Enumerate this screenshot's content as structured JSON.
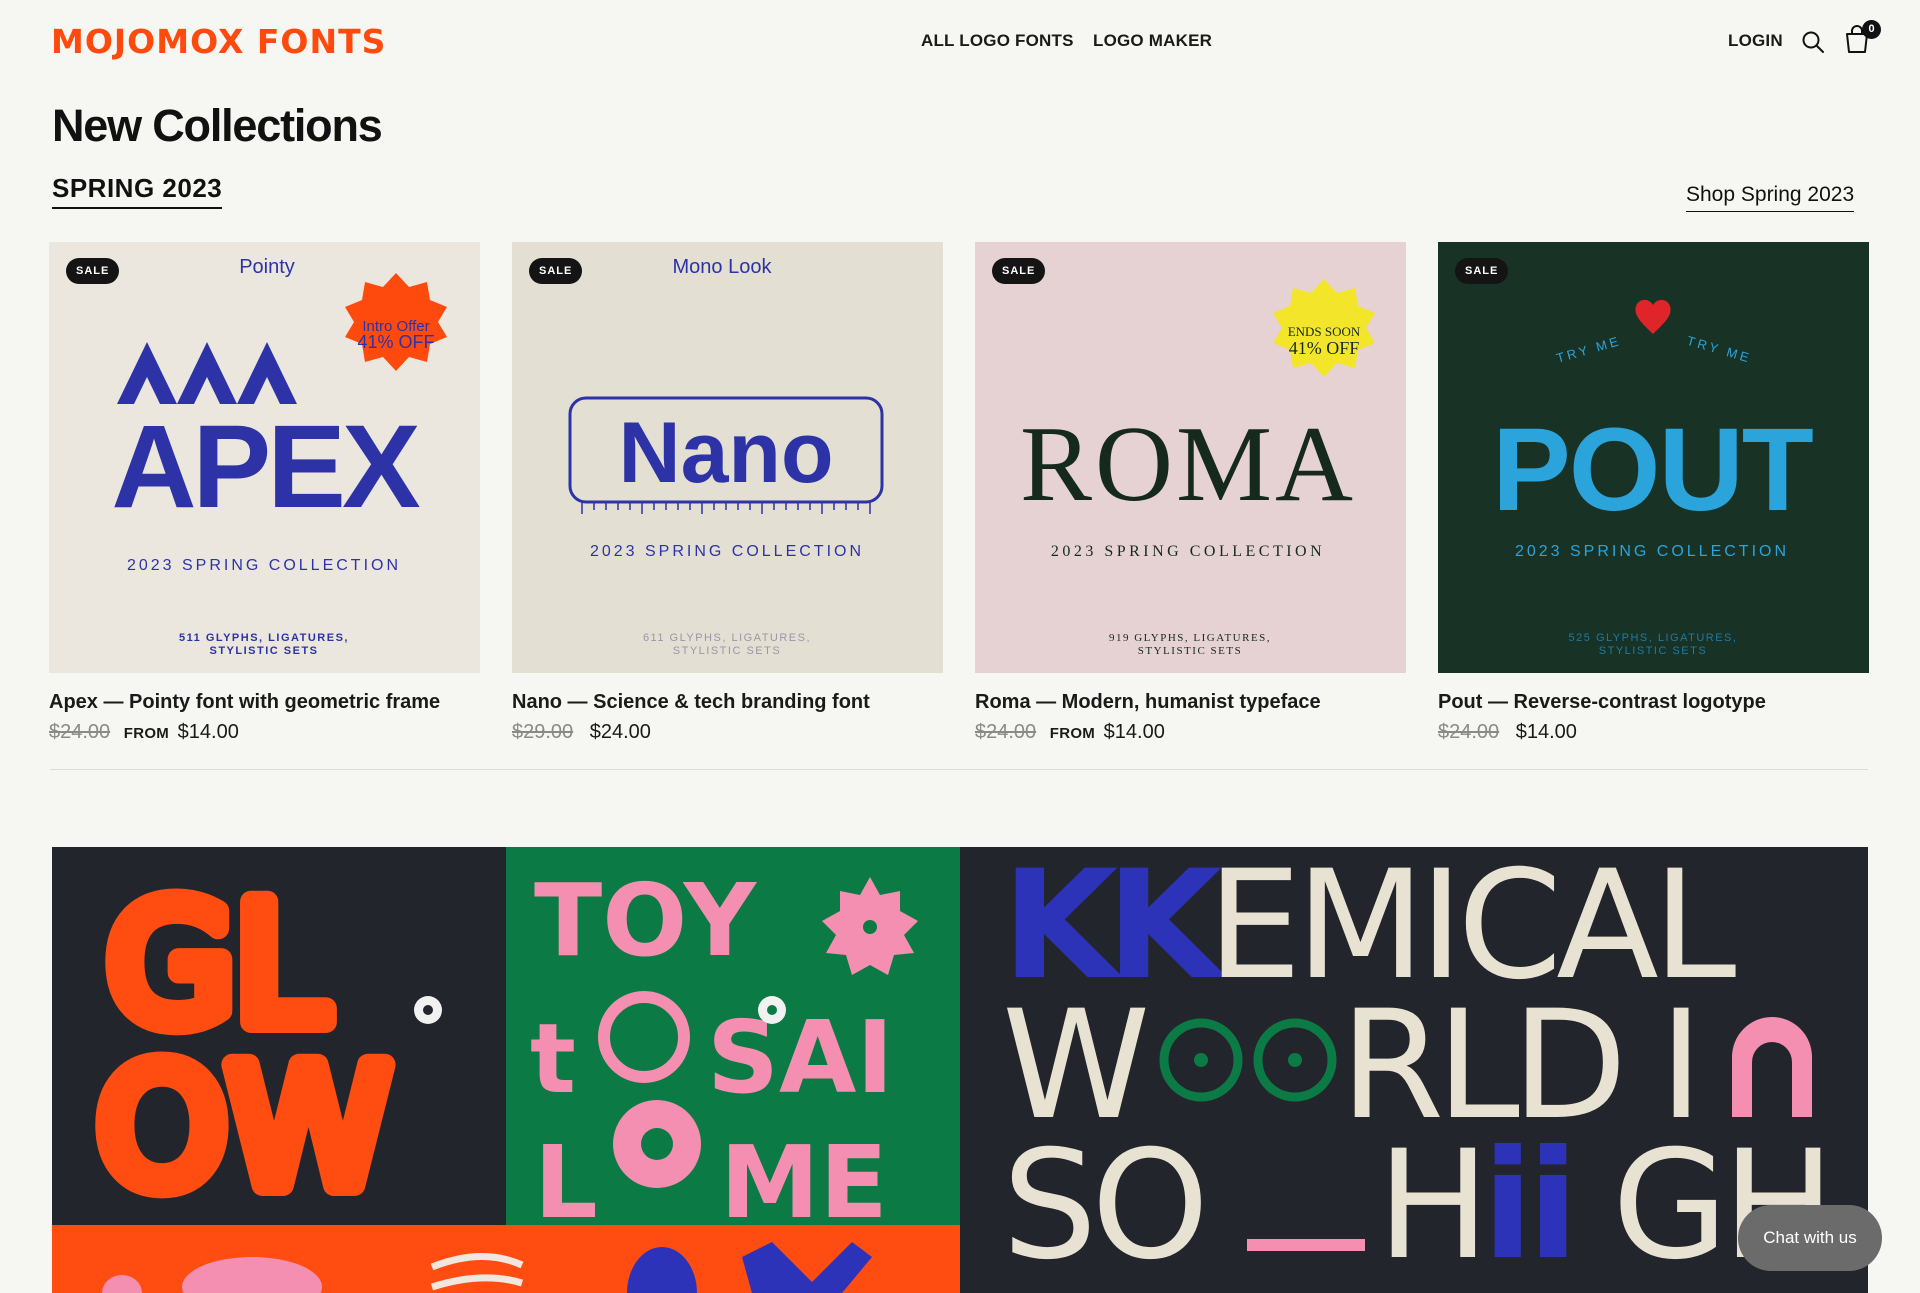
{
  "brand": {
    "logo": "MOJOMOX FONTS",
    "color": "#ff4a0e"
  },
  "nav": {
    "all_logo_fonts": "ALL LOGO FONTS",
    "logo_maker": "LOGO MAKER",
    "login": "LOGIN",
    "search_icon": "search-icon",
    "cart_icon": "cart-icon",
    "cart_count": "0"
  },
  "page": {
    "title": "New Collections",
    "season": "SPRING 2023",
    "shop_link": "Shop Spring 2023"
  },
  "products": [
    {
      "badge": "SALE",
      "art": {
        "bg": "#ebe7de",
        "accent": "#2d33a6",
        "name_tag": "Pointy",
        "wordmark": "APEX",
        "top_row": "AAA",
        "collection": "2023 SPRING COLLECTION",
        "specs_line1": "511 GLYPHS, LIGATURES,",
        "specs_line2": "STYLISTIC SETS",
        "burst_line1": "Intro Offer",
        "burst_line2": "41% OFF",
        "burst_color": "#ff4a0e"
      },
      "title": "Apex — Pointy font with geometric frame",
      "old_price": "$24.00",
      "from_label": "FROM",
      "price": "$14.00"
    },
    {
      "badge": "SALE",
      "art": {
        "bg": "#e4dfd3",
        "accent": "#2d33a6",
        "name_tag": "Mono Look",
        "wordmark": "Nano",
        "collection": "2023 SPRING COLLECTION",
        "specs_line1": "611 GLYPHS, LIGATURES,",
        "specs_line2": "STYLISTIC SETS"
      },
      "title": "Nano — Science & tech branding font",
      "old_price": "$29.00",
      "from_label": "",
      "price": "$24.00"
    },
    {
      "badge": "SALE",
      "art": {
        "bg": "#e6d2d2",
        "accent": "#16291f",
        "wordmark": "ROMA",
        "collection": "2023 SPRING COLLECTION",
        "specs_line1": "919 GLYPHS, LIGATURES,",
        "specs_line2": "STYLISTIC SETS",
        "burst_line1": "ENDS SOON",
        "burst_line2": "41% OFF",
        "burst_color": "#f3e62a"
      },
      "title": "Roma — Modern, humanist typeface",
      "old_price": "$24.00",
      "from_label": "FROM",
      "price": "$14.00"
    },
    {
      "badge": "SALE",
      "art": {
        "bg": "#183226",
        "accent": "#2ba4dc",
        "wordmark": "POUT",
        "arc_left": "TRY ME",
        "arc_right": "TRY ME",
        "collection": "2023 SPRING COLLECTION",
        "specs_line1": "525 GLYPHS, LIGATURES,",
        "specs_line2": "STYLISTIC SETS"
      },
      "title": "Pout — Reverse-contrast logotype",
      "old_price": "$24.00",
      "from_label": "",
      "price": "$14.00"
    }
  ],
  "banner": {
    "glow": {
      "line1": "GL",
      "line2": "OW",
      "bg": "#22252c",
      "color": "#ff4d12"
    },
    "toy": {
      "line1": "TOY",
      "line2": "SAI",
      "line3": "ME",
      "bg": "#0c7a44",
      "color": "#f48fb1"
    },
    "chemical": {
      "line1_accent": "KK",
      "line1_rest": "EMICAL",
      "line2_start": "W",
      "line2_rest": "RLD I",
      "line3_start": "SO",
      "line3_mid": "_",
      "line3_accent": "ii",
      "line3_end": "GH",
      "line3_h": "H",
      "bg": "#22252c",
      "color": "#e8e2d3",
      "accent": "#2d33b8",
      "pink": "#f48fb1",
      "green": "#0c7a44"
    },
    "strip_color": "#ff4d12"
  },
  "chat": {
    "label": "Chat with us"
  }
}
